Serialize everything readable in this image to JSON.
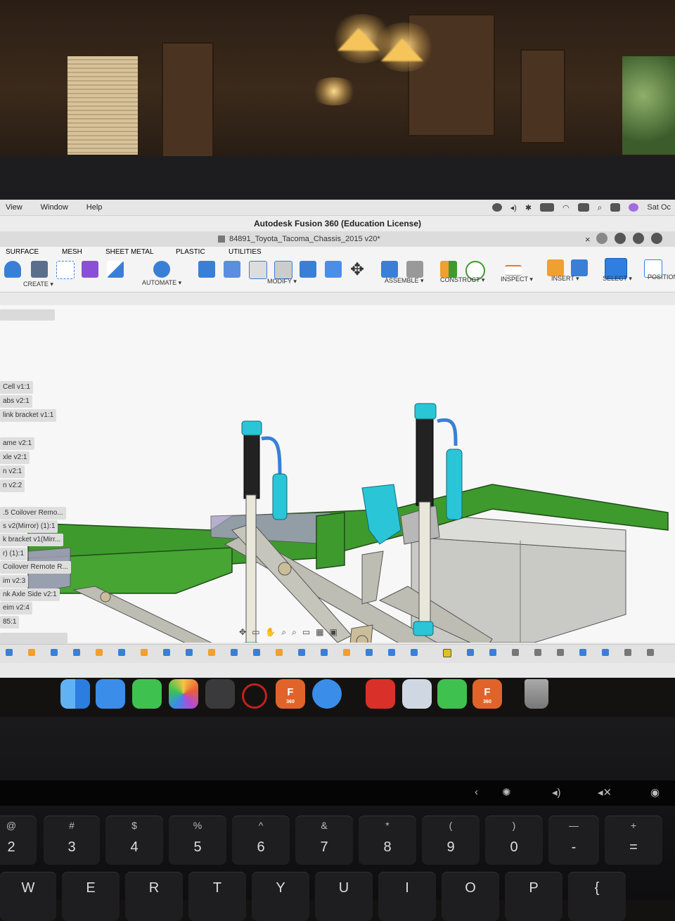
{
  "menubar": {
    "items": [
      "View",
      "Window",
      "Help"
    ],
    "clock": "Sat Oc"
  },
  "window": {
    "title": "Autodesk Fusion 360 (Education License)",
    "document_tab": "84891_Toyota_Tacoma_Chassis_2015 v20*",
    "close_glyph": "×",
    "new_tab_glyph": "+"
  },
  "ribbon": {
    "workspace_tabs": [
      "SURFACE",
      "MESH",
      "SHEET METAL",
      "PLASTIC",
      "UTILITIES"
    ],
    "groups": [
      "CREATE ▾",
      "AUTOMATE ▾",
      "MODIFY ▾",
      "ASSEMBLE ▾",
      "CONSTRUCT ▾",
      "INSPECT ▾",
      "INSERT ▾",
      "SELECT ▾",
      "POSITION"
    ]
  },
  "browser": {
    "items": [
      "Cell v1:1",
      "abs v2:1",
      "link bracket v1:1",
      "ame v2:1",
      "xle v2:1",
      "n v2:1",
      "n v2:2",
      ".5 Coilover Remo...",
      "s v2(Mirror) (1):1",
      "k bracket v1(Mirr...",
      "r) (1):1",
      "Coilover Remote R...",
      "im v2:3",
      "nk Axle Side v2:1",
      "eim v2:4",
      "85:1"
    ]
  },
  "dock": {
    "apps": [
      "finder",
      "mail",
      "messages",
      "photos",
      "calculator",
      "drag-app",
      "fusion-360",
      "safari",
      "acrobat",
      "preview",
      "facetime",
      "fusion-360",
      "trash"
    ],
    "fusion_letter": "F",
    "fusion_caption": "360"
  },
  "keyboard": {
    "number_row": [
      {
        "top": "@",
        "main": "2"
      },
      {
        "top": "#",
        "main": "3"
      },
      {
        "top": "$",
        "main": "4"
      },
      {
        "top": "%",
        "main": "5"
      },
      {
        "top": "^",
        "main": "6"
      },
      {
        "top": "&",
        "main": "7"
      },
      {
        "top": "*",
        "main": "8"
      },
      {
        "top": "(",
        "main": "9"
      },
      {
        "top": ")",
        "main": "0"
      },
      {
        "top": "—",
        "main": "-"
      },
      {
        "top": "+",
        "main": "="
      }
    ],
    "letter_row": [
      "W",
      "E",
      "R",
      "T",
      "Y",
      "U",
      "I",
      "O",
      "P",
      "{"
    ]
  },
  "colors": {
    "frame_green": "#3f9a2e",
    "shock_cyan": "#2bc5d8",
    "remote_line": "#3a7fd6",
    "link_gray": "#bdbdb4",
    "tank_gray": "#c9c9c6"
  }
}
